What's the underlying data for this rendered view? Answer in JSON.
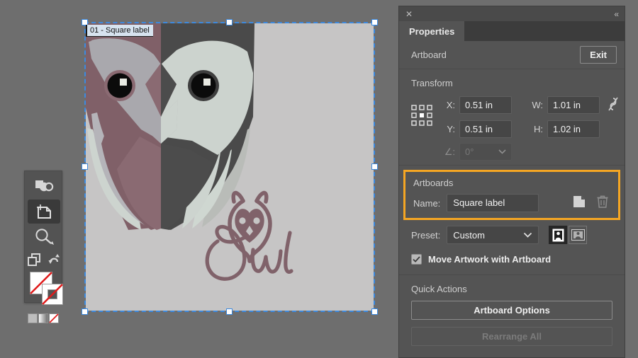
{
  "app": {
    "canvas_bg": "#6e6e6e",
    "artboard_bg": "#c6c5c5",
    "selection_color": "#3c8ae0",
    "highlight_color": "#f5a623"
  },
  "canvas": {
    "artboard_label": "01 - Square label",
    "artwork": {
      "name": "owl-illustration",
      "logo_text": "Owl",
      "palette": {
        "light_gray": "#c6c5c5",
        "face_light": "#cbd3ce",
        "face_mid": "#a9a8ad",
        "mauve": "#8a6a72",
        "mauve_dark": "#806068",
        "dark_gray": "#4c4c4c",
        "darkest": "#3f3f3f",
        "pale_sage": "#cfd7d1",
        "mid_sage": "#b9bcb8",
        "eye_black": "#0b0b0b",
        "eye_highlight": "#e8eae3"
      }
    },
    "selection_handles": 8
  },
  "toolbar": {
    "name": "tools-panel",
    "tools": [
      {
        "name": "artboard-stack-icon",
        "label": "Artboard Stack",
        "active": false
      },
      {
        "name": "artboard-tool-icon",
        "label": "Artboard Tool",
        "active": true
      },
      {
        "name": "zoom-tool-icon",
        "label": "Zoom Tool",
        "active": false
      },
      {
        "name": "shape-builder-icon",
        "label": "Shape Builder",
        "active": false
      },
      {
        "name": "swap-arrow-icon",
        "label": "Swap Fill and Stroke",
        "active": false
      }
    ],
    "fill_stroke": {
      "fill": "none",
      "stroke": "none",
      "swatches": [
        "color",
        "gradient",
        "none"
      ]
    }
  },
  "panel": {
    "close_icon": "✕",
    "collapse_icon": "«",
    "tabs": [
      {
        "label": "Properties",
        "active": true
      }
    ],
    "object_type": "Artboard",
    "exit_label": "Exit",
    "transform": {
      "title": "Transform",
      "anchor_icon": "reference-point-grid",
      "fields": [
        {
          "label": "X:",
          "value": "0.51 in"
        },
        {
          "label": "W:",
          "value": "1.01 in"
        },
        {
          "label": "Y:",
          "value": "0.51 in"
        },
        {
          "label": "H:",
          "value": "1.02 in"
        }
      ],
      "x_label": "X:",
      "x_value": "0.51 in",
      "y_label": "Y:",
      "y_value": "0.51 in",
      "w_label": "W:",
      "w_value": "1.01 in",
      "h_label": "H:",
      "h_value": "1.02 in",
      "link_icon": "broken-link-icon",
      "rotate_label": "∠:",
      "rotate_value": "0°",
      "rotate_disabled": true
    },
    "artboards": {
      "title": "Artboards",
      "highlighted": true,
      "name_label": "Name:",
      "name_value": "Square label",
      "new_artboard_icon": "new-artboard-icon",
      "delete_artboard_icon": "trash-icon"
    },
    "preset": {
      "label": "Preset:",
      "value": "Custom",
      "options": [
        "Custom"
      ],
      "orientation": [
        {
          "name": "portrait",
          "selected": true
        },
        {
          "name": "landscape",
          "selected": false
        }
      ]
    },
    "move_artwork": {
      "label": "Move Artwork with Artboard",
      "checked": true
    },
    "quick_actions": {
      "title": "Quick Actions",
      "buttons": [
        {
          "label": "Artboard Options",
          "disabled": false
        },
        {
          "label": "Rearrange All",
          "disabled": true
        }
      ]
    }
  }
}
